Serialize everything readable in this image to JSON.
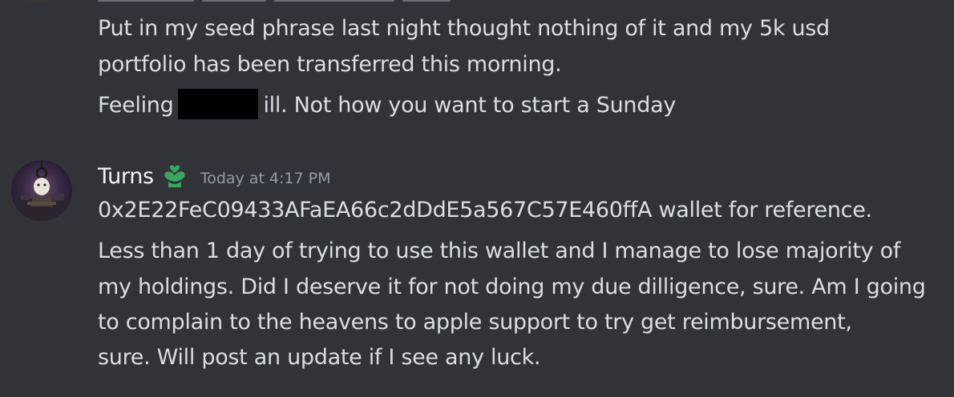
{
  "previous_message": {
    "lines": [
      "Put in my seed phrase last night thought nothing of it and my 5k usd",
      "portfolio has been transferred this morning."
    ],
    "feeling_before": "Feeling",
    "feeling_after": "ill. Not how you want to start a Sunday"
  },
  "message": {
    "username": "Turns",
    "timestamp": "Today at 4:17 PM",
    "wallet_line": "0x2E22FeC09433AFaEA66c2dDdE5a567C57E460ffA wallet for reference.",
    "body_lines": [
      "Less than 1 day of trying to use this wallet and I manage to lose majority of",
      "my holdings. Did I deserve it for not doing my due dilligence, sure. Am I going",
      "to complain to the heavens to apple support to try get reimbursement,",
      "sure. Will post an update if I see any luck."
    ]
  },
  "icons": {
    "avatar": "user-avatar",
    "role": "heart-hands-role-icon"
  },
  "colors": {
    "background": "#313338",
    "text": "#dbdee1",
    "username": "#f2f3f5",
    "timestamp": "#949ba4",
    "role_icon": "#3ba55d"
  }
}
